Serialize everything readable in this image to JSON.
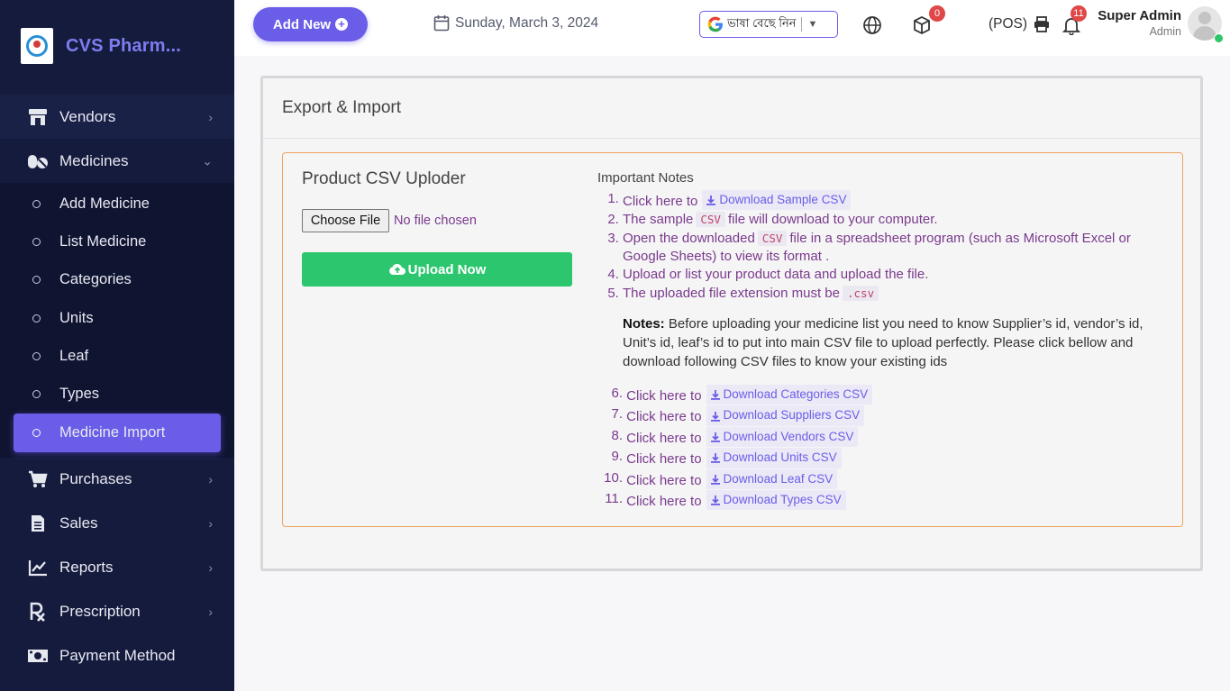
{
  "sidebar": {
    "brand": "CVS Pharm...",
    "items": [
      {
        "label": "Vendors",
        "icon": "store-icon"
      },
      {
        "label": "Medicines",
        "icon": "pills-icon"
      }
    ],
    "medicine_sub": [
      {
        "label": "Add Medicine"
      },
      {
        "label": "List Medicine"
      },
      {
        "label": "Categories"
      },
      {
        "label": "Units"
      },
      {
        "label": "Leaf"
      },
      {
        "label": "Types"
      },
      {
        "label": "Medicine Import",
        "active": true
      }
    ],
    "bottom_items": [
      {
        "label": "Purchases",
        "icon": "cart-icon"
      },
      {
        "label": "Sales",
        "icon": "receipt-icon"
      },
      {
        "label": "Reports",
        "icon": "chart-line-icon"
      },
      {
        "label": "Prescription",
        "icon": "prescription-icon"
      },
      {
        "label": "Payment Method",
        "icon": "money-icon"
      }
    ]
  },
  "topbar": {
    "add_new": "Add New",
    "date": "Sunday, March 3, 2024",
    "translate_label": "ভাষা বেছে নিন",
    "cart_badge": "0",
    "pos_label": "(POS)",
    "notif_badge": "11",
    "user_name": "Super Admin",
    "user_role": "Admin"
  },
  "page": {
    "title": "Export & Import",
    "uploader_title": "Product CSV Uploder",
    "choose_file": "Choose File",
    "no_file": "No file chosen",
    "upload_button": "Upload Now",
    "notes_title": "Important Notes",
    "steps": {
      "s1": {
        "num": "1.",
        "text": "Click here to",
        "link": "Download Sample CSV"
      },
      "s2a": "The sample",
      "s2code": "CSV",
      "s2b": "file will download to your computer.",
      "s3a": "Open the downloaded",
      "s3code": "CSV",
      "s3b": "file in a spreadsheet program (such as Microsoft Excel or Google Sheets) to view its format .",
      "s4": "Upload or list your product data and upload the file.",
      "s5a": "The uploaded file extension must be",
      "s5code": ".csv"
    },
    "notes_bold": "Notes:",
    "notes_text": "Before uploading your medicine list you need to know Supplier’s id, vendor’s id, Unit’s id, leaf’s id to put into main CSV file to upload perfectly. Please click bellow and download following CSV files to know your existing ids",
    "downloads": [
      {
        "num": "6.",
        "text": "Click here to",
        "link": "Download Categories CSV"
      },
      {
        "num": "7.",
        "text": "Click here to",
        "link": "Download Suppliers CSV"
      },
      {
        "num": "8.",
        "text": "Click here to",
        "link": "Download Vendors CSV"
      },
      {
        "num": "9.",
        "text": "Click here to",
        "link": "Download Units CSV"
      },
      {
        "num": "10.",
        "text": "Click here to",
        "link": "Download Leaf CSV"
      },
      {
        "num": "11.",
        "text": "Click here to",
        "link": "Download Types CSV"
      }
    ]
  },
  "colors": {
    "accent": "#6a5de8",
    "sidebar": "#151b3d",
    "success": "#2bc66e",
    "note_border": "#f0a35c",
    "note_text": "#7a3a8c"
  }
}
